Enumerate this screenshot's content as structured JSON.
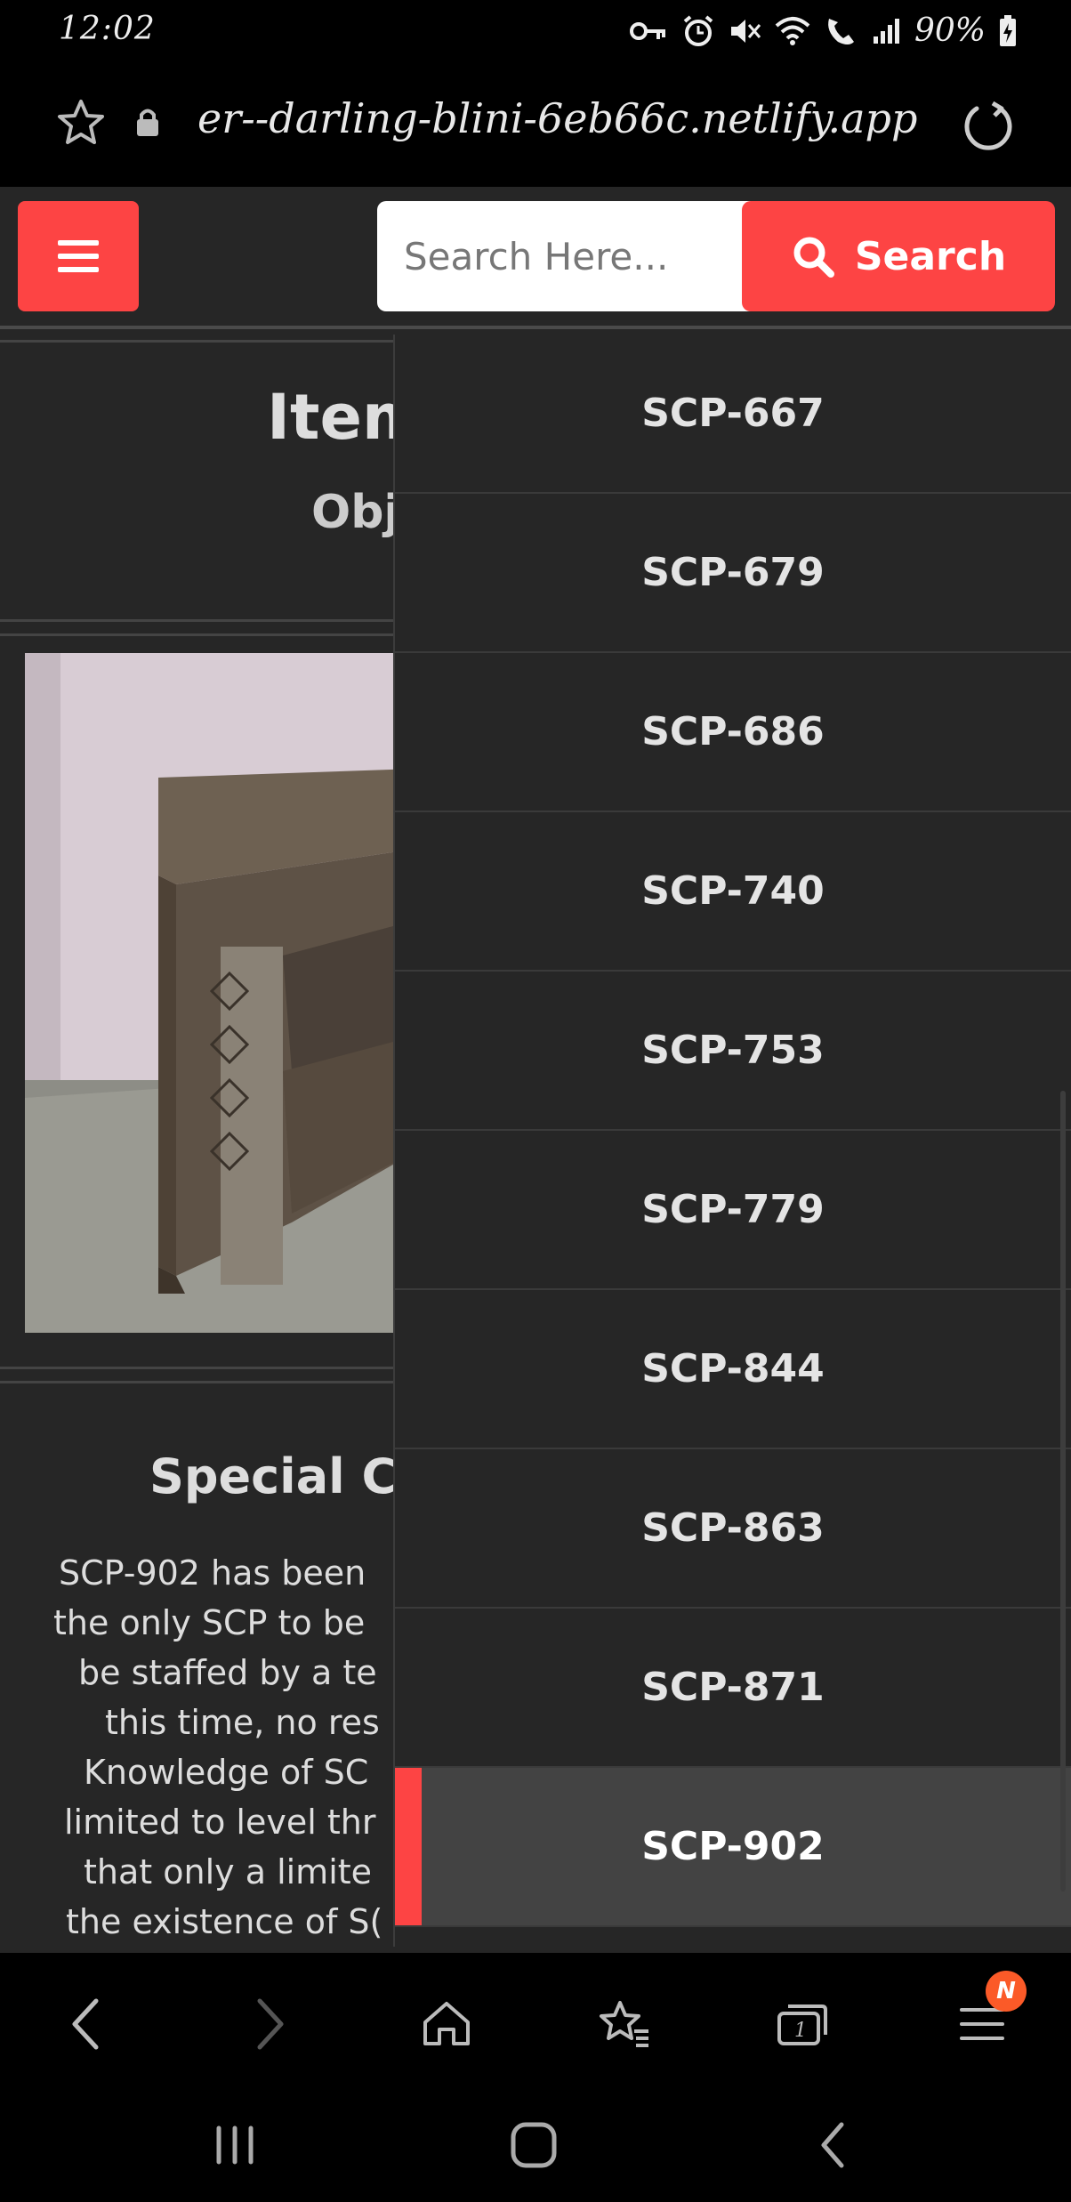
{
  "status_bar": {
    "time": "12:02",
    "battery": "90%",
    "icons": [
      "key-icon",
      "alarm-icon",
      "mute-icon",
      "wifi-icon",
      "wifi-calling-icon",
      "signal-icon",
      "battery-charging-icon"
    ]
  },
  "browser": {
    "url": "er--darling-blini-6eb66c.netlify.app"
  },
  "header": {
    "search_placeholder": "Search Here...",
    "search_label": "Search",
    "accent_color": "#fd4444"
  },
  "content": {
    "item_title": "Item",
    "object_class": "Obj",
    "special_heading": "Special Co",
    "description_lines": [
      "SCP-902 has been",
      "the only SCP to be",
      "be staffed by a te",
      "this time, no res",
      "Knowledge of SC",
      "limited to level thr",
      "that only a limite",
      "the existence of S("
    ]
  },
  "dropdown": {
    "items": [
      {
        "label": "SCP-667"
      },
      {
        "label": "SCP-679"
      },
      {
        "label": "SCP-686"
      },
      {
        "label": "SCP-740"
      },
      {
        "label": "SCP-753"
      },
      {
        "label": "SCP-779"
      },
      {
        "label": "SCP-844"
      },
      {
        "label": "SCP-863"
      },
      {
        "label": "SCP-871"
      },
      {
        "label": "SCP-902"
      }
    ],
    "active": "SCP-902"
  },
  "bottom_bar": {
    "tabs_badge": "N"
  }
}
